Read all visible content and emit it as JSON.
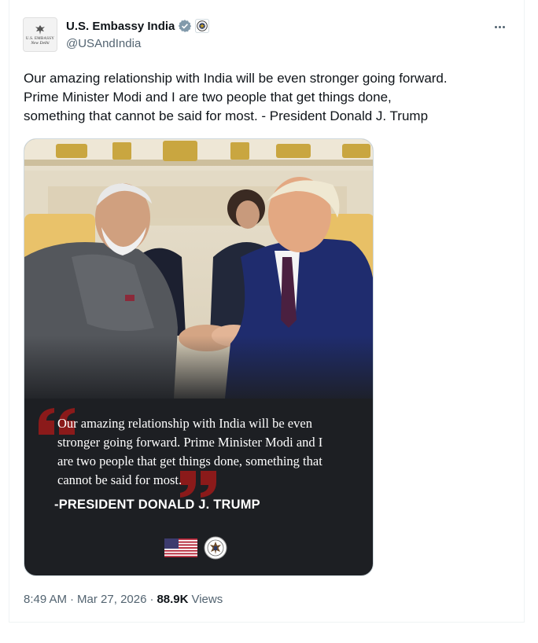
{
  "account": {
    "display_name": "U.S. Embassy India",
    "handle": "@USAndIndia",
    "verified_badge": "verified-badge-icon",
    "affiliation_badge": "state-dept-seal-icon",
    "avatar_line1": "U.S. EMBASSY",
    "avatar_line2": "New Delhi"
  },
  "tweet": {
    "text": "Our amazing relationship with India will be even stronger going forward.\nPrime Minister Modi and I are two people that get things done,\nsomething that cannot be said for most. - President Donald J. Trump"
  },
  "media": {
    "quote": "Our amazing relationship with India will be even\nstronger going forward. Prime Minister Modi and I\nare two people that get things done, something that\ncannot be said for most.",
    "attribution": "-PRESIDENT DONALD J. TRUMP",
    "quote_mark_color": "#8b1a1a",
    "background_color": "#1d1f23"
  },
  "footer": {
    "time": "8:49 AM",
    "separator": "·",
    "date": "Mar 27, 2026",
    "views_count": "88.9K",
    "views_label": "Views"
  },
  "colors": {
    "verified_gray": "#829aab",
    "text_primary": "#0f1419",
    "text_secondary": "#536471"
  }
}
